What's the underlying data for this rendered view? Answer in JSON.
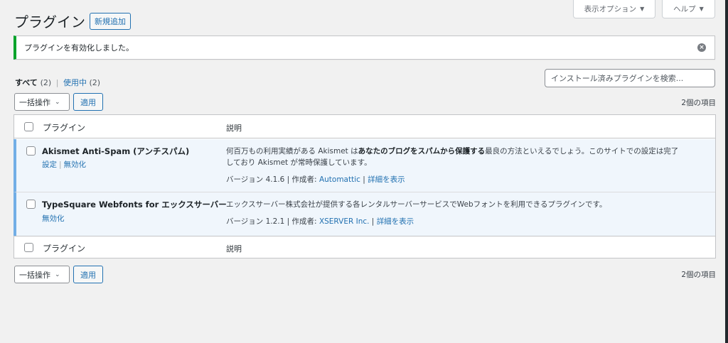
{
  "header": {
    "screen_options": "表示オプション",
    "help": "ヘルプ",
    "title": "プラグイン",
    "add_new": "新規追加"
  },
  "notice": {
    "message": "プラグインを有効化しました。"
  },
  "filters": {
    "all_label": "すべて",
    "all_count": "(2)",
    "active_label": "使用中",
    "active_count": "(2)"
  },
  "search": {
    "placeholder": "インストール済みプラグインを検索..."
  },
  "bulk": {
    "label": "一括操作",
    "apply": "適用",
    "items_count": "2個の項目"
  },
  "table": {
    "col_plugin": "プラグイン",
    "col_desc": "説明"
  },
  "plugins": [
    {
      "name": "Akismet Anti-Spam (アンチスパム)",
      "actions": [
        "設定",
        "無効化"
      ],
      "desc_line1_pre": "何百万もの利用実績がある Akismet は",
      "desc_line1_bold": "あなたのブログをスパムから保護する",
      "desc_line1_post": "最良の方法といえるでしょう。このサイトでの設定は完了",
      "desc_line2": "しており Akismet が常時保護しています。",
      "version_label": "バージョン 4.1.6 | 作成者: ",
      "author": "Automattic",
      "details": "詳細を表示"
    },
    {
      "name": "TypeSquare Webfonts for エックスサーバー",
      "actions": [
        "無効化"
      ],
      "desc_line1": "エックスサーバー株式会社が提供する各レンタルサーバーサービスでWebフォントを利用できるプラグインです。",
      "version_label": "バージョン 1.2.1 | 作成者: ",
      "author": "XSERVER Inc.",
      "details": "詳細を表示"
    }
  ],
  "colors": {
    "accent": "#2271b1",
    "active_border": "#72aee6",
    "notice_success": "#00a32a"
  }
}
